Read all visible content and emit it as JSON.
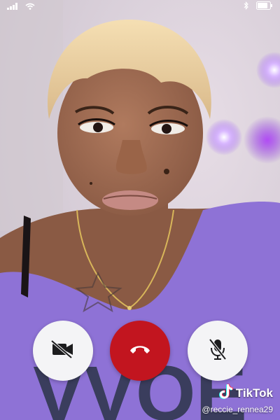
{
  "status_bar": {
    "icons": [
      "signal-icon",
      "wifi-icon",
      "bluetooth-icon",
      "battery-icon"
    ]
  },
  "call_controls": {
    "buttons": [
      {
        "name": "video-off-button",
        "icon": "video-off-icon",
        "color": "#f4f4f6"
      },
      {
        "name": "end-call-button",
        "icon": "hang-up-icon",
        "color": "#c2151f"
      },
      {
        "name": "mute-button",
        "icon": "mic-off-icon",
        "color": "#f4f4f6"
      }
    ]
  },
  "watermark": {
    "brand": "TikTok",
    "handle": "@reccie_rennea29",
    "icon": "tiktok-logo-icon"
  },
  "colors": {
    "end_call": "#c2151f",
    "shirt": "#8e72d6",
    "background_light": "#9b5cf0"
  }
}
